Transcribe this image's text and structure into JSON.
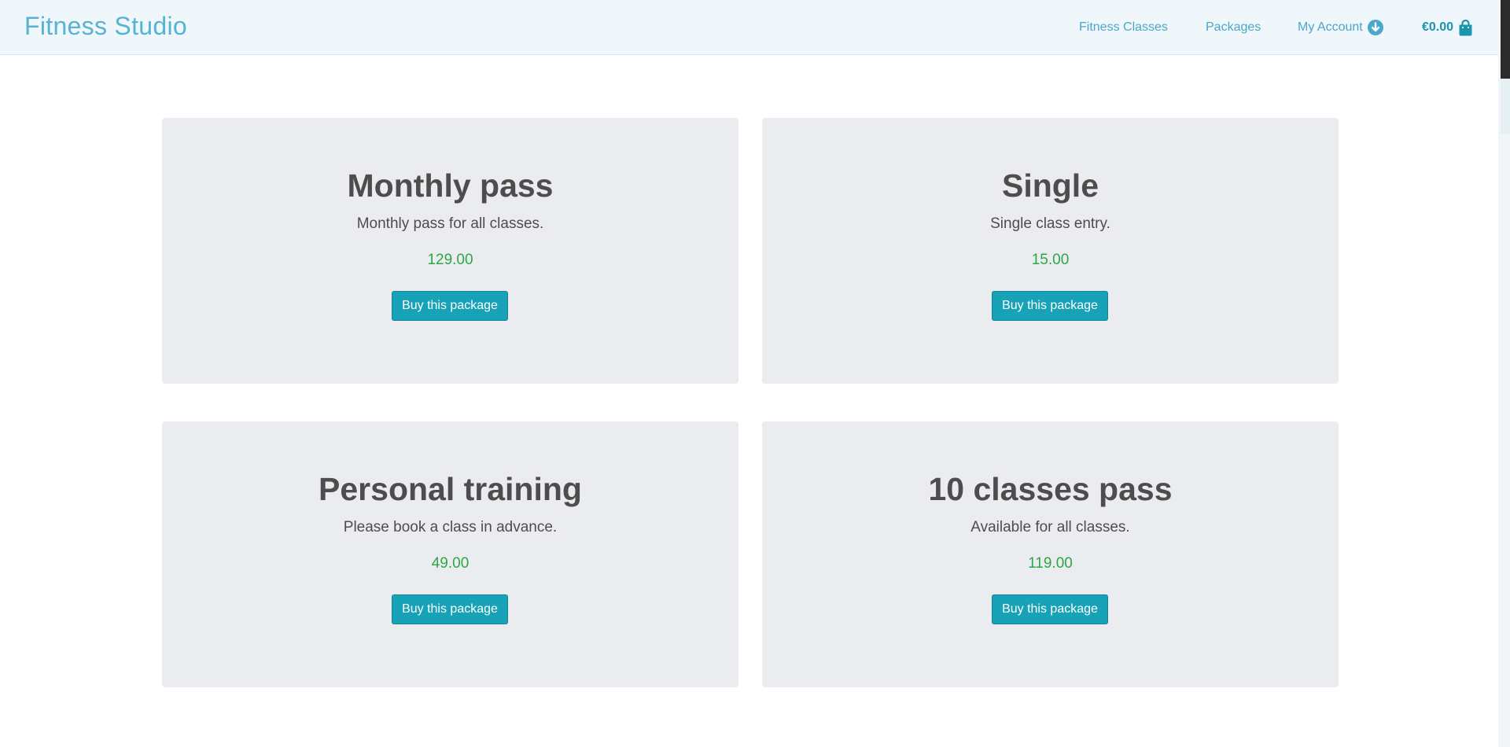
{
  "header": {
    "brand": "Fitness Studio",
    "nav": {
      "classes": "Fitness Classes",
      "packages": "Packages",
      "account": "My Account",
      "account_icon": "arrow-down-circle-icon"
    },
    "cart": {
      "total": "€0.00",
      "icon": "shopping-bag-icon"
    }
  },
  "packages": [
    {
      "title": "Monthly pass",
      "description": "Monthly pass for all classes.",
      "price": "129.00",
      "button": "Buy this package"
    },
    {
      "title": "Single",
      "description": "Single class entry.",
      "price": "15.00",
      "button": "Buy this package"
    },
    {
      "title": "Personal training",
      "description": "Please book a class in advance.",
      "price": "49.00",
      "button": "Buy this package"
    },
    {
      "title": "10 classes pass",
      "description": "Available for all classes.",
      "price": "119.00",
      "button": "Buy this package"
    }
  ],
  "colors": {
    "brand": "#55b4d4",
    "nav_link": "#4aa8c8",
    "header_bg": "#eff7fa",
    "card_bg": "#ebecf0",
    "price": "#2aa847",
    "button": "#17a2b8"
  }
}
